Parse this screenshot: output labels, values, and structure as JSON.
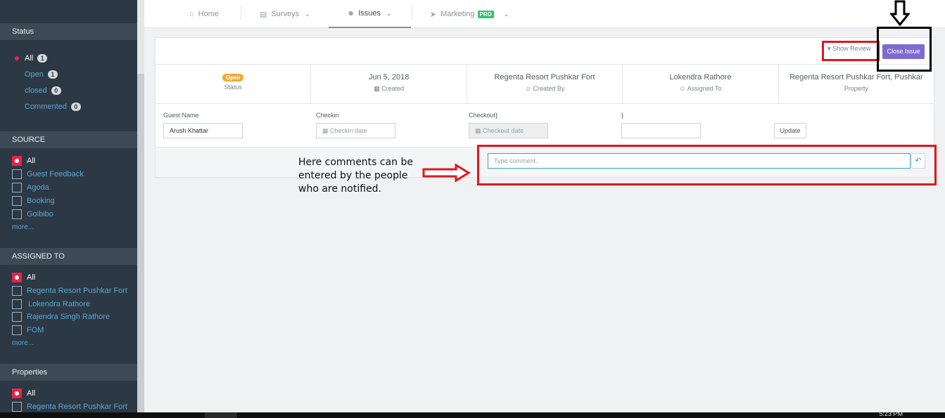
{
  "sidebar": {
    "status_header": "Status",
    "status_items": [
      {
        "label": "All",
        "count": "1"
      },
      {
        "label": "Open",
        "count": "1"
      },
      {
        "label": "closed",
        "count": "0"
      },
      {
        "label": "Commented",
        "count": "0"
      }
    ],
    "source_header": "SOURCE",
    "source_items": [
      "All",
      "Guest Feedback",
      "Agoda",
      "Booking",
      "Goibibo"
    ],
    "source_more": "more...",
    "assigned_header": "ASSIGNED TO",
    "assigned_items": [
      "All",
      "Regenta Resort Pushkar Fort",
      "Lokendra Rathore",
      "Rajendra Singh Rathore",
      "FOM"
    ],
    "assigned_more": "more...",
    "properties_header": "Properties",
    "properties_items": [
      "All",
      "Regenta Resort Pushkar Fort"
    ]
  },
  "nav": {
    "home": "Home",
    "surveys": "Surveys",
    "issues": "Issues",
    "marketing": "Marketing",
    "pro_badge": "PRO"
  },
  "toolbar": {
    "show_review": "Show Review",
    "close_issue": "Close Issue"
  },
  "info": {
    "status_value": "Open",
    "status_label": "Status",
    "created_value": "Jun 5, 2018",
    "created_label": "Created",
    "created_by_value": "Regenta Resort Pushkar Fort",
    "created_by_label": "Created By",
    "assigned_value": "Lokendra Rathore",
    "assigned_label": "Assigned To",
    "property_value": "Regenta Resort Pushkar Fort, Pushkar",
    "property_label": "Property"
  },
  "form": {
    "guest_name_label": "Guest Name",
    "guest_name_value": "Arush Khattar",
    "checkin_label": "Checkin",
    "checkin_placeholder": "Checkin date",
    "checkout_label": "Checkout}",
    "checkout_placeholder": "Checkout date",
    "extra_label": "}",
    "update": "Update"
  },
  "comment": {
    "placeholder": "Type comment.."
  },
  "annotation": {
    "note": "Here comments can be entered by the people who are notified."
  },
  "taskbar": {
    "clock": "5:23 PM"
  },
  "colors": {
    "sidebar_bg": "#2c3844",
    "accent_red": "#e8234c",
    "link_blue": "#5aa8d6",
    "close_issue_purple": "#7e6bd0",
    "annotation_red": "#e0171d",
    "open_pill": "#f0a836",
    "pro_green": "#34c36a"
  }
}
